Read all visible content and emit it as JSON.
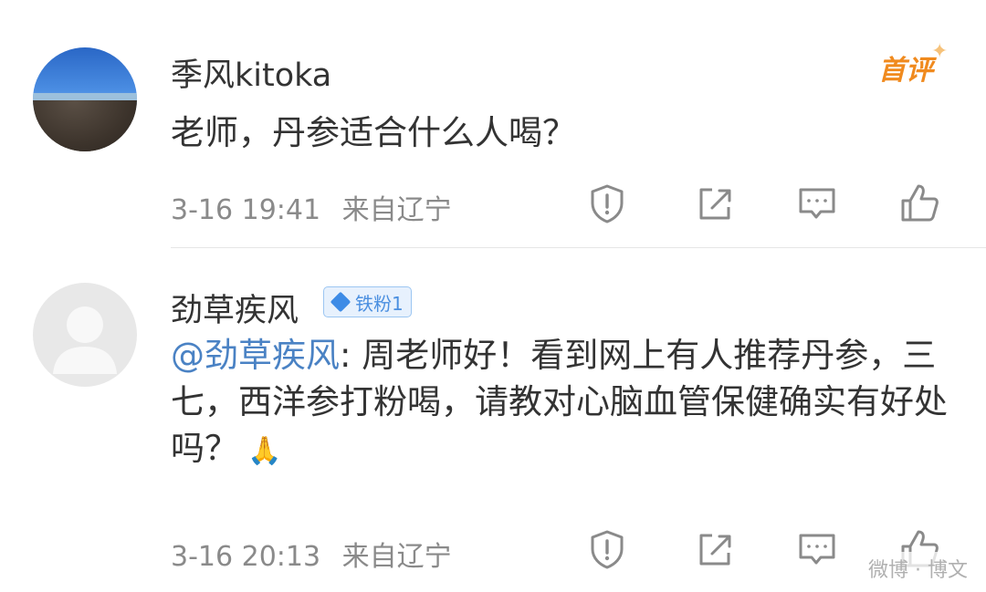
{
  "comments": [
    {
      "username": "季风kitoka",
      "badge": "首评",
      "text": "老师，丹参适合什么人喝？",
      "time": "3-16 19:41",
      "location": "来自辽宁"
    },
    {
      "username": "劲草疾风",
      "fan_badge": "铁粉1",
      "mention": "@劲草疾风",
      "text": ": 周老师好！看到网上有人推荐丹参，三七，西洋参打粉喝，请教对心脑血管保健确实有好处吗？",
      "emoji": "🙏",
      "time": "3-16 20:13",
      "location": "来自辽宁"
    }
  ],
  "icons": {
    "report": "shield-report-icon",
    "share": "share-icon",
    "reply": "comment-icon",
    "like": "thumbs-up-icon"
  },
  "colors": {
    "mention": "#4a82c4",
    "first_badge": "#f08a1e",
    "fan_badge": "#4a8fe0",
    "meta": "#8a8a8a"
  },
  "watermark": "微博 · 博文"
}
